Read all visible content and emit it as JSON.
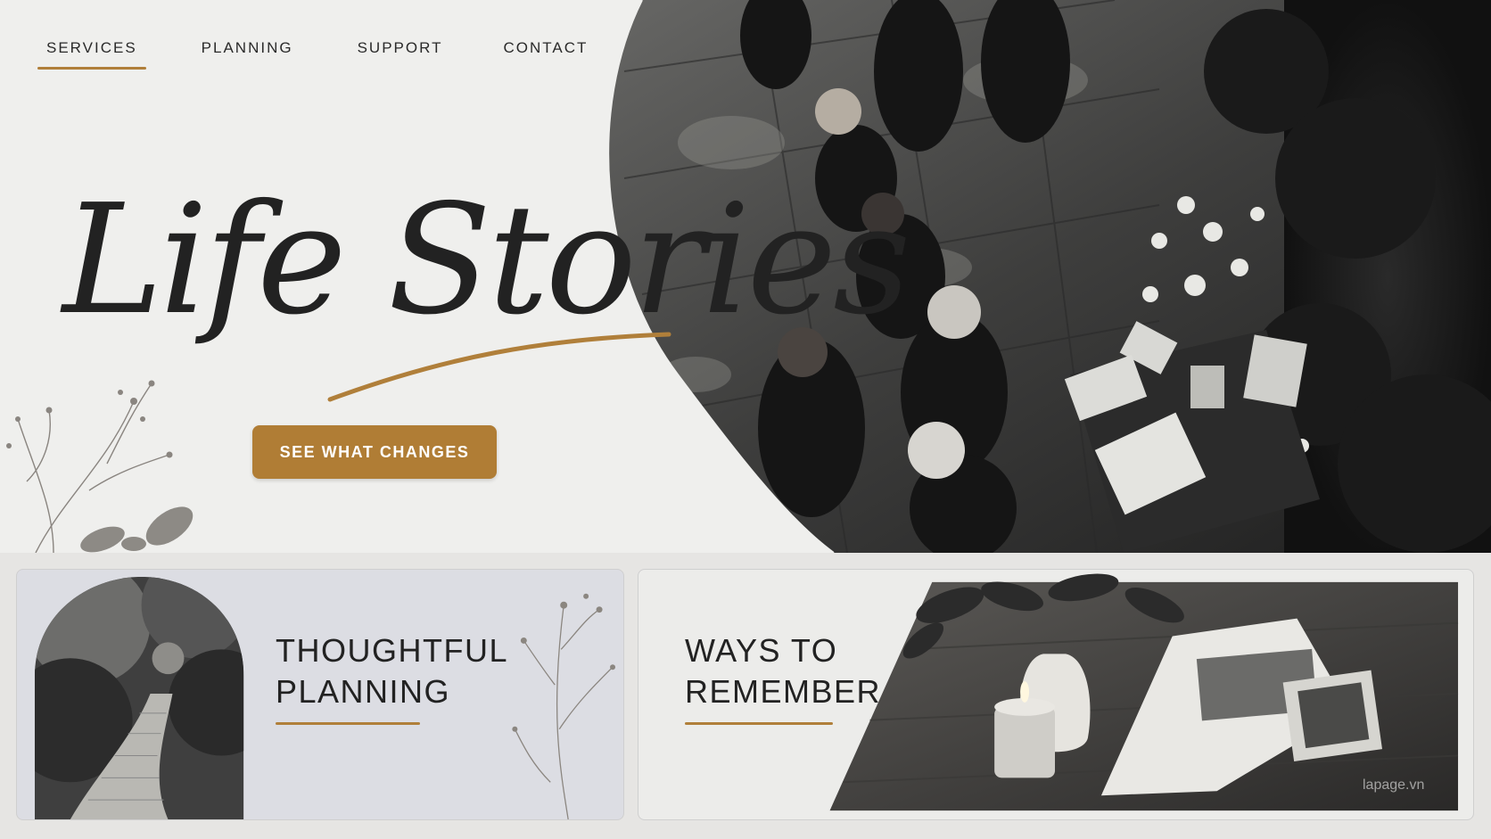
{
  "nav": {
    "items": [
      {
        "label": "SERVICES",
        "active": true
      },
      {
        "label": "PLANNING",
        "active": false
      },
      {
        "label": "SUPPORT",
        "active": false
      },
      {
        "label": "CONTACT",
        "active": false
      }
    ]
  },
  "hero": {
    "title": "Life Stories",
    "cta_label": "SEE WHAT CHANGES"
  },
  "cards": [
    {
      "title": "THOUGHTFUL\nPLANNING"
    },
    {
      "title": "WAYS TO\nREMEMBER"
    }
  ],
  "watermark": "lapage.vn",
  "colors": {
    "accent": "#b07d35",
    "hero_bg": "#efefed",
    "text": "#222222"
  },
  "icons": {
    "hero": "gathering-photo",
    "card_planning": "garden-path-photo",
    "card_remember": "candle-memory-book-photo"
  }
}
